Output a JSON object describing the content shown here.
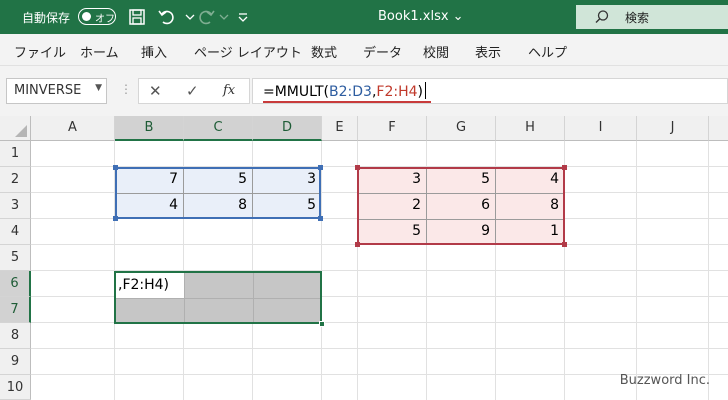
{
  "titlebar": {
    "autosave_label": "自動保存",
    "toggle_state": "オフ",
    "filename": "Book1.xlsx",
    "filename_arrow": "⌄",
    "search_label": "検索",
    "bg_color": "#217346"
  },
  "ribbon": {
    "tabs": [
      "ファイル",
      "ホーム",
      "挿入",
      "ページ レイアウト",
      "数式",
      "データ",
      "校閲",
      "表示",
      "ヘルプ"
    ]
  },
  "formula_bar": {
    "name_box": "MINVERSE",
    "fx_label": "fx",
    "formula_prefix": "=MMULT(",
    "formula_ref1": "B2:D3",
    "formula_sep": ",",
    "formula_ref2": "F2:H4",
    "formula_suffix": ")"
  },
  "grid": {
    "columns": [
      "A",
      "B",
      "C",
      "D",
      "E",
      "F",
      "G",
      "H",
      "I",
      "J"
    ],
    "rows": [
      "1",
      "2",
      "3",
      "4",
      "5",
      "6",
      "7",
      "8",
      "9",
      "10"
    ],
    "range_b2_d3": [
      [
        7,
        5,
        3
      ],
      [
        4,
        8,
        5
      ]
    ],
    "range_f2_h4": [
      [
        3,
        5,
        4
      ],
      [
        2,
        6,
        8
      ],
      [
        5,
        9,
        1
      ]
    ],
    "active_cell_text": ",F2:H4)"
  },
  "watermark": "Buzzword Inc."
}
